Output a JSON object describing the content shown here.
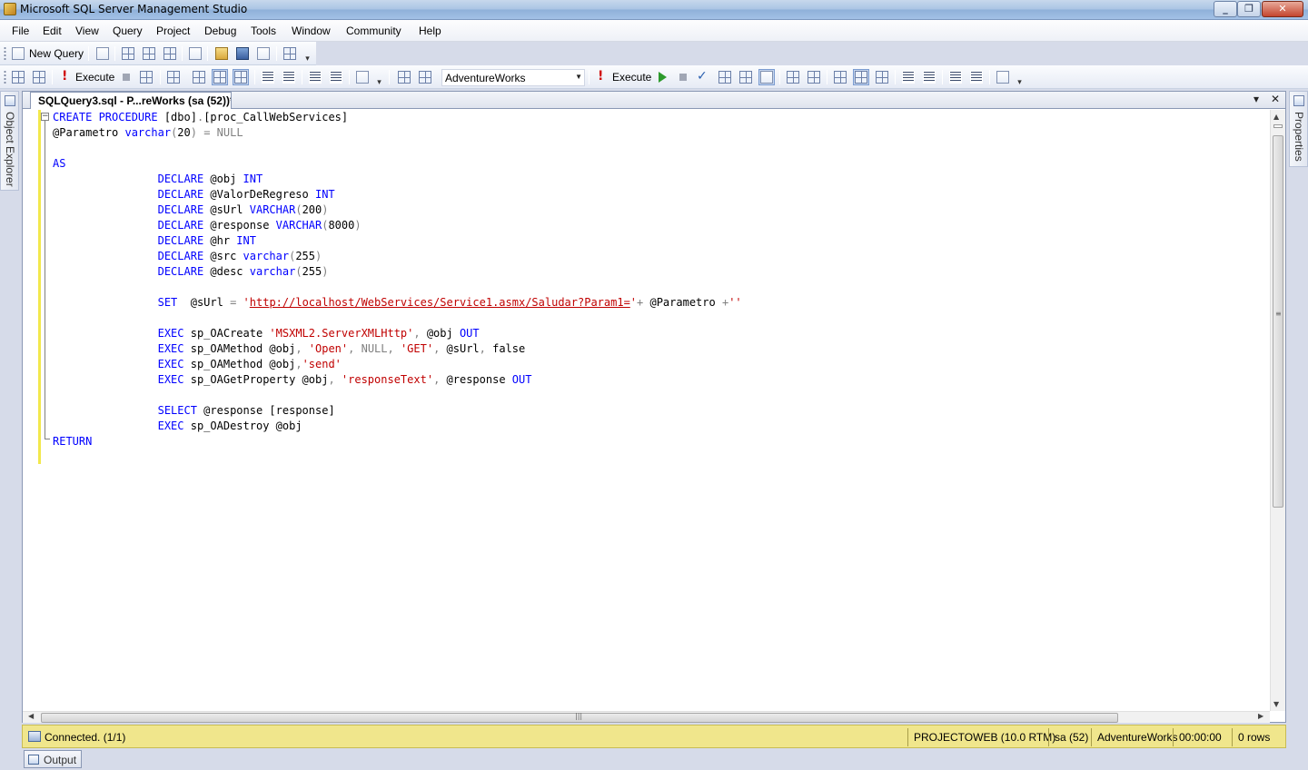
{
  "window": {
    "title": "Microsoft SQL Server Management Studio"
  },
  "menu": [
    "File",
    "Edit",
    "View",
    "Query",
    "Project",
    "Debug",
    "Tools",
    "Window",
    "Community",
    "Help"
  ],
  "toolbar1": {
    "new_query_label": "New Query"
  },
  "toolbar2": {
    "execute_label": "Execute",
    "database": "AdventureWorks",
    "execute2_label": "Execute"
  },
  "side_panes": {
    "left": "Object Explorer",
    "right": "Properties"
  },
  "document_tab": {
    "label": "SQLQuery3.sql - P...reWorks (sa (52))*"
  },
  "code_lines": [
    [
      [
        "kw",
        "CREATE PROCEDURE "
      ],
      [
        "t",
        "[dbo]"
      ],
      [
        "op",
        "."
      ],
      [
        "t",
        "[proc_CallWebServices]"
      ]
    ],
    [
      [
        "t",
        "@Parametro "
      ],
      [
        "kw",
        "varchar"
      ],
      [
        "op",
        "("
      ],
      [
        "t",
        "20"
      ],
      [
        "op",
        ") = NULL"
      ]
    ],
    [],
    [
      [
        "kw",
        "AS"
      ]
    ],
    [
      [
        "t",
        "                "
      ],
      [
        "kw",
        "DECLARE "
      ],
      [
        "t",
        "@obj "
      ],
      [
        "kw",
        "INT"
      ]
    ],
    [
      [
        "t",
        "                "
      ],
      [
        "kw",
        "DECLARE "
      ],
      [
        "t",
        "@ValorDeRegreso "
      ],
      [
        "kw",
        "INT"
      ]
    ],
    [
      [
        "t",
        "                "
      ],
      [
        "kw",
        "DECLARE "
      ],
      [
        "t",
        "@sUrl "
      ],
      [
        "kw",
        "VARCHAR"
      ],
      [
        "op",
        "("
      ],
      [
        "t",
        "200"
      ],
      [
        "op",
        ")"
      ]
    ],
    [
      [
        "t",
        "                "
      ],
      [
        "kw",
        "DECLARE "
      ],
      [
        "t",
        "@response "
      ],
      [
        "kw",
        "VARCHAR"
      ],
      [
        "op",
        "("
      ],
      [
        "t",
        "8000"
      ],
      [
        "op",
        ")"
      ]
    ],
    [
      [
        "t",
        "                "
      ],
      [
        "kw",
        "DECLARE "
      ],
      [
        "t",
        "@hr "
      ],
      [
        "kw",
        "INT"
      ]
    ],
    [
      [
        "t",
        "                "
      ],
      [
        "kw",
        "DECLARE "
      ],
      [
        "t",
        "@src "
      ],
      [
        "kw",
        "varchar"
      ],
      [
        "op",
        "("
      ],
      [
        "t",
        "255"
      ],
      [
        "op",
        ")"
      ]
    ],
    [
      [
        "t",
        "                "
      ],
      [
        "kw",
        "DECLARE "
      ],
      [
        "t",
        "@desc "
      ],
      [
        "kw",
        "varchar"
      ],
      [
        "op",
        "("
      ],
      [
        "t",
        "255"
      ],
      [
        "op",
        ")"
      ]
    ],
    [],
    [
      [
        "t",
        "                "
      ],
      [
        "kw",
        "SET  "
      ],
      [
        "t",
        "@sUrl "
      ],
      [
        "op",
        "= "
      ],
      [
        "str",
        "'"
      ],
      [
        "url",
        "http://localhost/WebServices/Service1.asmx/Saludar?Param1="
      ],
      [
        "str",
        "'"
      ],
      [
        "op",
        "+ "
      ],
      [
        "t",
        "@Parametro "
      ],
      [
        "op",
        "+"
      ],
      [
        "str",
        "''"
      ]
    ],
    [],
    [
      [
        "t",
        "                "
      ],
      [
        "kw",
        "EXEC "
      ],
      [
        "t",
        "sp_OACreate "
      ],
      [
        "str",
        "'MSXML2.ServerXMLHttp'"
      ],
      [
        "op",
        ", "
      ],
      [
        "t",
        "@obj "
      ],
      [
        "kw",
        "OUT"
      ]
    ],
    [
      [
        "t",
        "                "
      ],
      [
        "kw",
        "EXEC "
      ],
      [
        "t",
        "sp_OAMethod "
      ],
      [
        "t",
        "@obj"
      ],
      [
        "op",
        ", "
      ],
      [
        "str",
        "'Open'"
      ],
      [
        "op",
        ", NULL, "
      ],
      [
        "str",
        "'GET'"
      ],
      [
        "op",
        ", "
      ],
      [
        "t",
        "@sUrl"
      ],
      [
        "op",
        ", "
      ],
      [
        "t",
        "false"
      ]
    ],
    [
      [
        "t",
        "                "
      ],
      [
        "kw",
        "EXEC "
      ],
      [
        "t",
        "sp_OAMethod "
      ],
      [
        "t",
        "@obj"
      ],
      [
        "op",
        ","
      ],
      [
        "str",
        "'send'"
      ]
    ],
    [
      [
        "t",
        "                "
      ],
      [
        "kw",
        "EXEC "
      ],
      [
        "t",
        "sp_OAGetProperty "
      ],
      [
        "t",
        "@obj"
      ],
      [
        "op",
        ", "
      ],
      [
        "str",
        "'responseText'"
      ],
      [
        "op",
        ", "
      ],
      [
        "t",
        "@response "
      ],
      [
        "kw",
        "OUT"
      ]
    ],
    [],
    [
      [
        "t",
        "                "
      ],
      [
        "kw",
        "SELECT "
      ],
      [
        "t",
        "@response [response]"
      ]
    ],
    [
      [
        "t",
        "                "
      ],
      [
        "kw",
        "EXEC "
      ],
      [
        "t",
        "sp_OADestroy "
      ],
      [
        "t",
        "@obj"
      ]
    ],
    [
      [
        "kw",
        "RETURN"
      ]
    ]
  ],
  "status": {
    "connection": "Connected. (1/1)",
    "server": "PROJECTOWEB (10.0 RTM)",
    "user": "sa (52)",
    "database": "AdventureWorks",
    "elapsed": "00:00:00",
    "rows": "0 rows"
  },
  "output_tab": {
    "label": "Output"
  },
  "colors": {
    "keyword": "#0000ff",
    "string": "#c00000",
    "operator": "#808080",
    "status_bar": "#f0e68c",
    "margin_marker": "#f2e84c"
  }
}
